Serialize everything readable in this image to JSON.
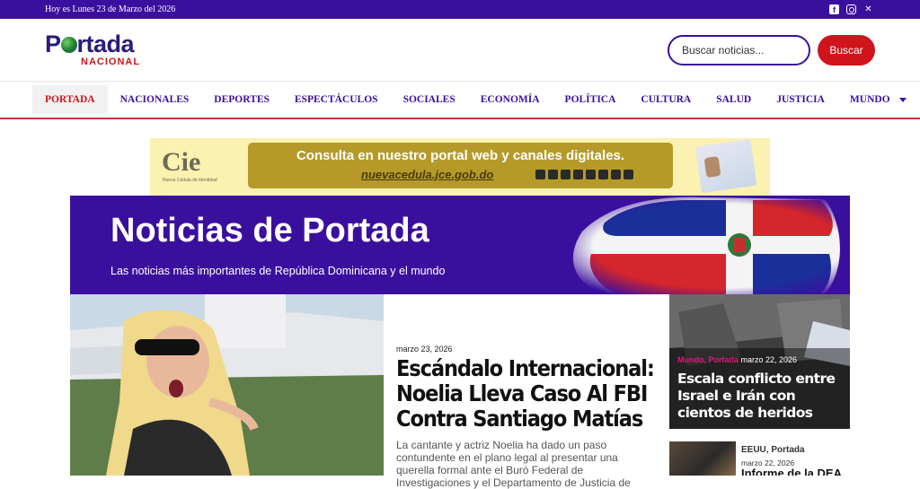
{
  "topbar": {
    "date": "Hoy es Lunes 23 de Marzo del 2026",
    "social_icons": [
      "facebook-icon",
      "instagram-icon",
      "x-icon"
    ]
  },
  "header": {
    "logo_line1": "Portada",
    "logo_line2": "NACIONAL",
    "search_placeholder": "Buscar noticias...",
    "search_button": "Buscar"
  },
  "nav": {
    "items": [
      "PORTADA",
      "NACIONALES",
      "DEPORTES",
      "ESPECTÁCULOS",
      "SOCIALES",
      "ECONOMÍA",
      "POLÍTICA",
      "CULTURA",
      "SALUD",
      "JUSTICIA",
      "MUNDO"
    ],
    "active_index": 0
  },
  "banner": {
    "brand": "Cie",
    "brand_sub": "Nueva Cédula de Identidad",
    "headline": "Consulta en nuestro portal web y canales digitales.",
    "url": "nuevacedula.jce.gob.do"
  },
  "hero": {
    "title": "Noticias de Portada",
    "subtitle": "Las noticias más importantes de República Dominicana y el mundo"
  },
  "featured": {
    "date": "marzo 23, 2026",
    "title": "Escándalo Internacional: Noelia Lleva Caso Al FBI Contra Santiago Matías",
    "excerpt": "La cantante y actriz Noelia ha dado un paso contundente en el plano legal al presentar una querella formal ante el Buró Federal de Investigaciones y el Departamento de Justicia de"
  },
  "side_stories": [
    {
      "categories": "Mundo, Portada",
      "date": "marzo 22, 2026",
      "title": "Escala conflicto entre Israel e Irán con cientos de heridos"
    },
    {
      "categories": "EEUU, Portada",
      "date": "marzo 22, 2026",
      "title": "Informe de la DEA"
    }
  ],
  "colors": {
    "brand_purple": "#3b0f9e",
    "accent_red": "#d0141b",
    "category_pink": "#e0157a"
  }
}
